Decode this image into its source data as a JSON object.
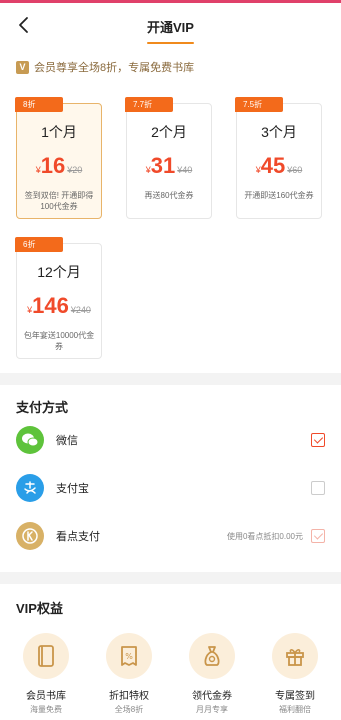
{
  "header": {
    "title": "开通VIP"
  },
  "notice": {
    "badge": "V",
    "text": "会员尊享全场8折，专属免费书库"
  },
  "plans": [
    {
      "discount": "8折",
      "title": "1个月",
      "yen": "¥",
      "price": "16",
      "original": "¥20",
      "desc": "签到双倍! 开通即得100代金券",
      "selected": true
    },
    {
      "discount": "7.7折",
      "title": "2个月",
      "yen": "¥",
      "price": "31",
      "original": "¥40",
      "desc": "再送80代金券",
      "selected": false
    },
    {
      "discount": "7.5折",
      "title": "3个月",
      "yen": "¥",
      "price": "45",
      "original": "¥60",
      "desc": "开通即送160代金券",
      "selected": false
    },
    {
      "discount": "6折",
      "title": "12个月",
      "yen": "¥",
      "price": "146",
      "original": "¥240",
      "desc": "包年宴送10000代金券",
      "selected": false
    }
  ],
  "payment": {
    "title": "支付方式",
    "methods": [
      {
        "label": "微信",
        "icon": "wechat-icon",
        "color": "#5ec33b",
        "checked": true
      },
      {
        "label": "支付宝",
        "icon": "alipay-icon",
        "color": "#2a9ee8",
        "checked": false
      },
      {
        "label": "看点支付",
        "icon": "kandian-coin-icon",
        "color": "#d8b166",
        "note": "使用0看点抵扣0.00元",
        "checked": true
      }
    ]
  },
  "benefits": {
    "title": "VIP权益",
    "items": [
      {
        "name": "会员书库",
        "sub": "海量免费",
        "icon": "book-library-icon"
      },
      {
        "name": "折扣特权",
        "sub": "全场8折",
        "icon": "discount-coupon-icon"
      },
      {
        "name": "领代金券",
        "sub": "月月专享",
        "icon": "voucher-bag-icon"
      },
      {
        "name": "专属签到",
        "sub": "福利翻倍",
        "icon": "gift-icon"
      }
    ]
  },
  "colors": {
    "accent": "#f04a2a",
    "tag": "#f36a1b",
    "gold": "#c79b53"
  }
}
